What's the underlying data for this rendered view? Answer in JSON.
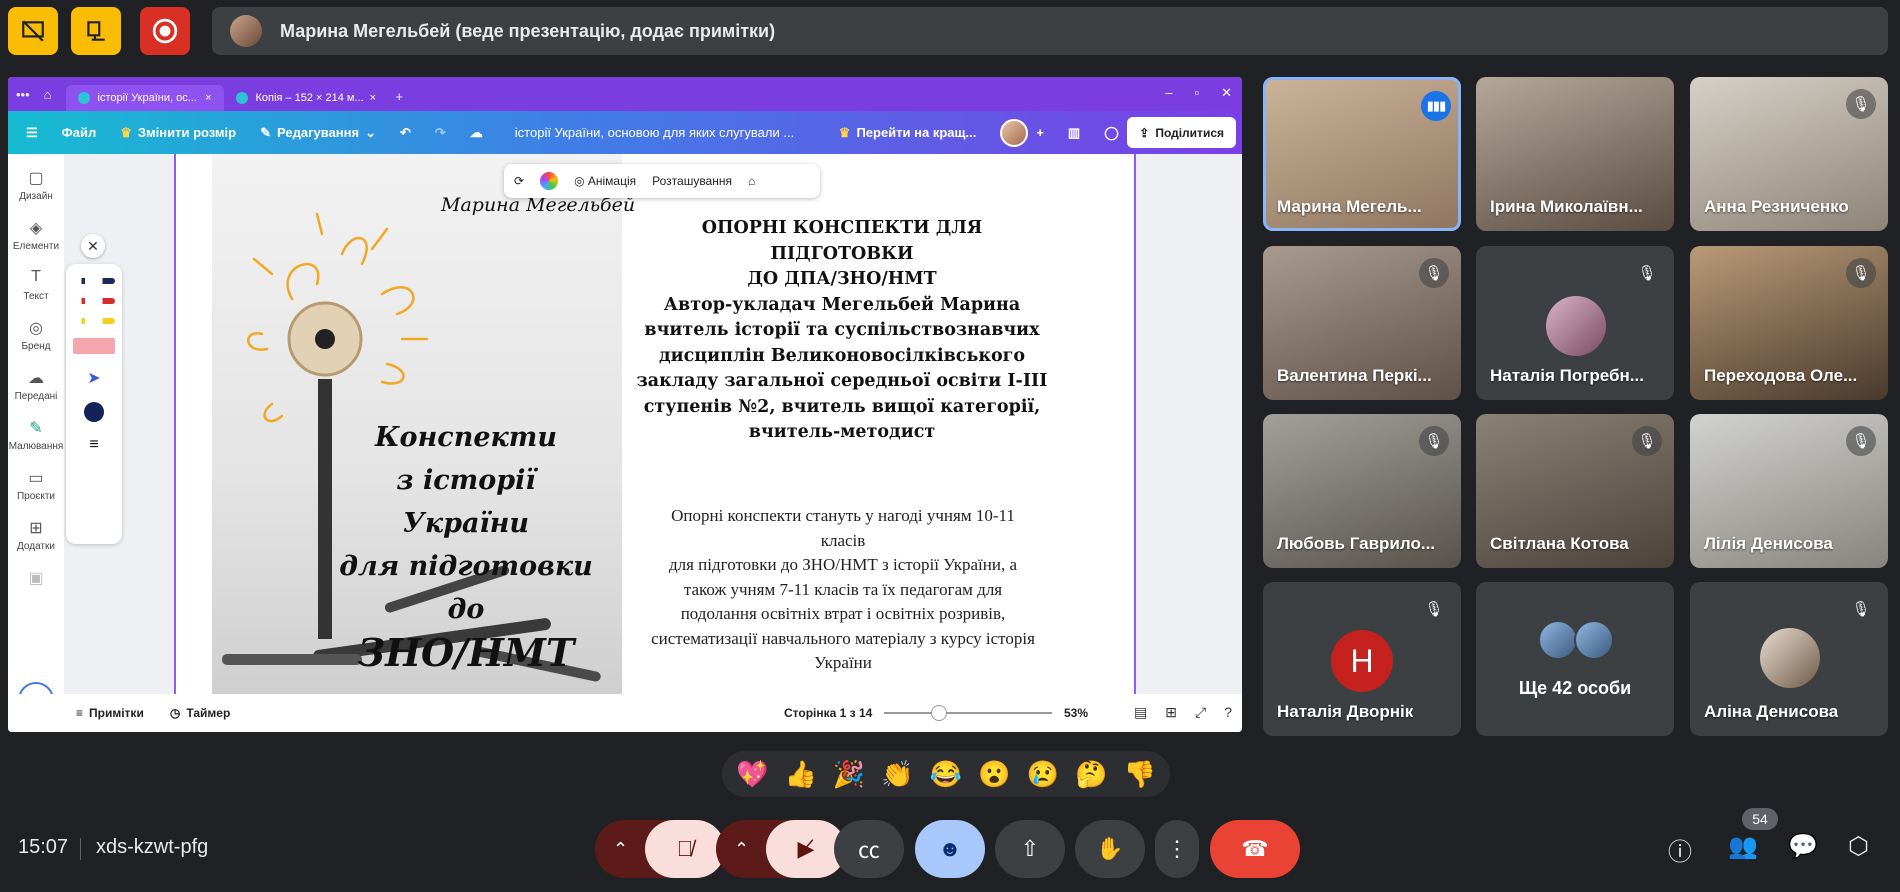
{
  "presenter_bar": {
    "text": "Марина Мегельбей (веде презентацію, додає примітки)"
  },
  "browser": {
    "tabs": [
      {
        "label": "історії України, ос...",
        "close": "×"
      },
      {
        "label": "Копія – 152 × 214 м...",
        "close": "×"
      }
    ],
    "new_tab": "+",
    "window_controls": [
      "–",
      "▫",
      "✕"
    ]
  },
  "canva_toolbar": {
    "menu_icon": "☰",
    "file": "Файл",
    "resize": "Змінити розмір",
    "edit": "Редагування",
    "undo": "↶",
    "redo": "↷",
    "cloud": "☁",
    "doc_title": "історії України, основою для яких слугували ...",
    "upgrade": "Перейти на кращ...",
    "plus": "+",
    "share": "Поділитися"
  },
  "left_rail": [
    {
      "label": "Дизайн",
      "icon": "▢"
    },
    {
      "label": "Елементи",
      "icon": "◈"
    },
    {
      "label": "Текст",
      "icon": "T"
    },
    {
      "label": "Бренд",
      "icon": "◎"
    },
    {
      "label": "Передані",
      "icon": "☁"
    },
    {
      "label": "Малювання",
      "icon": "✎"
    },
    {
      "label": "Проєкти",
      "icon": "▭"
    },
    {
      "label": "Додатки",
      "icon": "⊞"
    }
  ],
  "floating_bar": {
    "animation": "Анімація",
    "position": "Розташування"
  },
  "slide": {
    "author_script": "Марина Мегельбей",
    "cover_line1": "Конспекти",
    "cover_line2": "з історії України",
    "cover_line3": "для підготовки до",
    "cover_line4": "ЗНО/НМТ",
    "heading": [
      "ОПОРНІ КОНСПЕКТИ ДЛЯ ПІДГОТОВКИ",
      "ДО ДПА/ЗНО/НМТ",
      "Автор-укладач Мегельбей Марина",
      "вчитель історії та суспільствознавчих",
      "дисциплін Великоновосілківського",
      "закладу загальної середньої освіти I-III",
      "ступенів №2, вчитель вищої категорії,",
      "вчитель-методист"
    ],
    "body": [
      "Опорні конспекти стануть у нагоді учням 10-11 класів",
      "для підготовки до ЗНО/НМТ з історії України, а",
      "також учням 7-11 класів та їх педагогам для",
      "подолання освітніх втрат і освітніх розривів,",
      "систематизації навчального матеріалу з курсу історія",
      "України"
    ]
  },
  "footer": {
    "notes": "Примітки",
    "timer": "Таймер",
    "pager": "Сторінка 1 з 14",
    "zoom": "53%",
    "zoom_level": 0.33
  },
  "participants": [
    {
      "name": "Марина Мегель...",
      "speaking": true
    },
    {
      "name": "Ірина Миколаївн...",
      "muted": false
    },
    {
      "name": "Анна Резниченко",
      "muted": true
    },
    {
      "name": "Валентина Перкі...",
      "muted": true
    },
    {
      "name": "Наталія Погребн...",
      "muted": true
    },
    {
      "name": "Переходова Оле...",
      "muted": true
    },
    {
      "name": "Любовь Гаврило...",
      "muted": true
    },
    {
      "name": "Світлана Котова",
      "muted": true
    },
    {
      "name": "Лілія Денисова",
      "muted": true
    },
    {
      "name": "Наталія Дворнік",
      "initial": "Н",
      "muted": true
    },
    {
      "name": "Ще 42 особи"
    },
    {
      "name": "Аліна Денисова",
      "muted": true
    }
  ],
  "reactions": [
    "💖",
    "👍",
    "🎉",
    "👏",
    "😂",
    "😮",
    "😢",
    "🤔",
    "👎"
  ],
  "bottom_bar": {
    "time": "15:07",
    "meeting_code": "xds-kzwt-pfg",
    "participant_count": "54"
  },
  "colors": {
    "accent": "#8ab4f8",
    "hangup": "#ea4335",
    "brand_yellow": "#fbbc04"
  }
}
